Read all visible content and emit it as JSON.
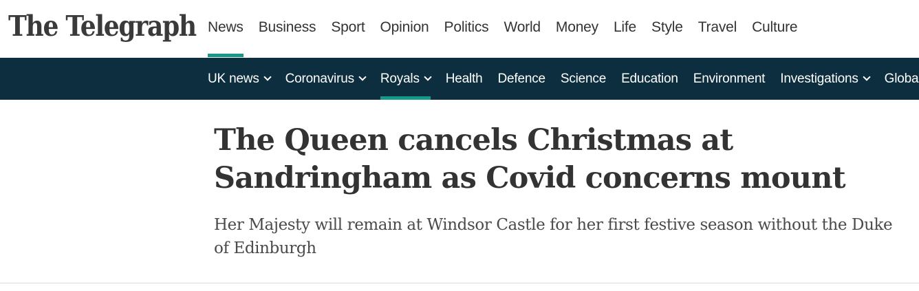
{
  "brand": {
    "logo_text": "The Telegraph"
  },
  "main_nav": {
    "items": [
      {
        "label": "News",
        "active": true
      },
      {
        "label": "Business"
      },
      {
        "label": "Sport"
      },
      {
        "label": "Opinion"
      },
      {
        "label": "Politics"
      },
      {
        "label": "World"
      },
      {
        "label": "Money"
      },
      {
        "label": "Life"
      },
      {
        "label": "Style"
      },
      {
        "label": "Travel"
      },
      {
        "label": "Culture"
      }
    ]
  },
  "sub_nav": {
    "items": [
      {
        "label": "UK news",
        "dropdown": true
      },
      {
        "label": "Coronavirus",
        "dropdown": true
      },
      {
        "label": "Royals",
        "dropdown": true,
        "active": true
      },
      {
        "label": "Health"
      },
      {
        "label": "Defence"
      },
      {
        "label": "Science"
      },
      {
        "label": "Education"
      },
      {
        "label": "Environment"
      },
      {
        "label": "Investigations",
        "dropdown": true
      },
      {
        "label": "Global Health Security"
      }
    ]
  },
  "article": {
    "headline": "The Queen cancels Christmas at Sandringham as Covid concerns mount",
    "standfirst": "Her Majesty will remain at Windsor Castle for her first festive season without the Duke of Edinburgh"
  },
  "colors": {
    "accent": "#15988a",
    "subnav_background": "#0c2e3e",
    "text": "#333333"
  }
}
